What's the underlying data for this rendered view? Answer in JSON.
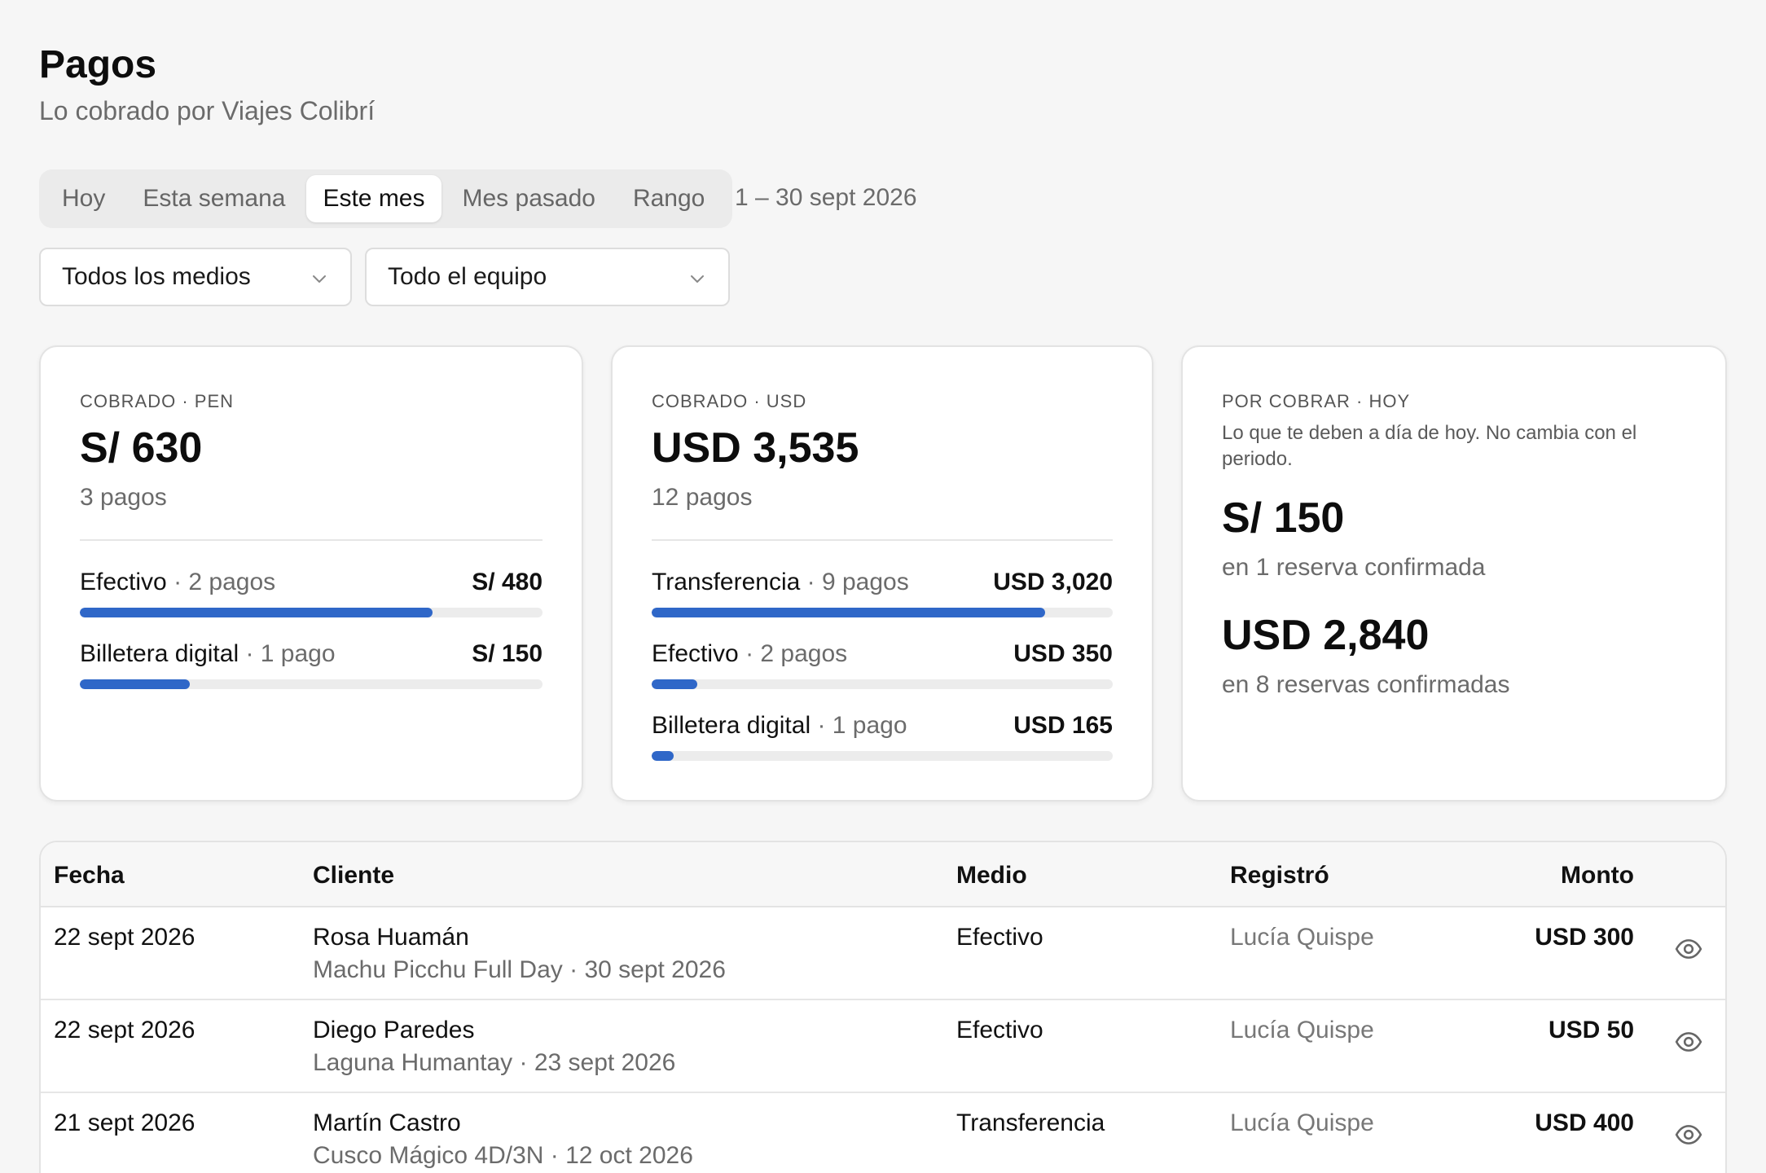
{
  "header": {
    "title": "Pagos",
    "subtitle": "Lo cobrado por Viajes Colibrí"
  },
  "period": {
    "tabs": [
      "Hoy",
      "Esta semana",
      "Este mes",
      "Mes pasado",
      "Rango"
    ],
    "active": "Este mes",
    "range_text": "1 – 30 sept 2026"
  },
  "filters": {
    "method": "Todos los medios",
    "team": "Todo el equipo"
  },
  "cards": {
    "pen": {
      "label": "COBRADO · PEN",
      "total": "S/ 630",
      "count": "3 pagos",
      "rows": [
        {
          "name": "Efectivo",
          "count": "· 2 pagos",
          "amount": "S/ 480",
          "share": 0.762
        },
        {
          "name": "Billetera digital",
          "count": "· 1 pago",
          "amount": "S/ 150",
          "share": 0.238
        }
      ]
    },
    "usd": {
      "label": "COBRADO · USD",
      "total": "USD 3,535",
      "count": "12 pagos",
      "rows": [
        {
          "name": "Transferencia",
          "count": "· 9 pagos",
          "amount": "USD 3,020",
          "share": 0.854
        },
        {
          "name": "Efectivo",
          "count": "· 2 pagos",
          "amount": "USD 350",
          "share": 0.099
        },
        {
          "name": "Billetera digital",
          "count": "· 1 pago",
          "amount": "USD 165",
          "share": 0.047
        }
      ]
    },
    "due": {
      "label": "POR COBRAR · HOY",
      "description": "Lo que te deben a día de hoy. No cambia con el periodo.",
      "pen_amount": "S/ 150",
      "pen_sub": "en 1 reserva confirmada",
      "usd_amount": "USD 2,840",
      "usd_sub": "en 8 reservas confirmadas"
    }
  },
  "table": {
    "headers": {
      "date": "Fecha",
      "client": "Cliente",
      "method": "Medio",
      "by": "Registró",
      "amount": "Monto"
    },
    "rows": [
      {
        "date": "22 sept 2026",
        "client": "Rosa Huamán",
        "detail": "Machu Picchu Full Day · 30 sept 2026",
        "method": "Efectivo",
        "by": "Lucía Quispe",
        "amount": "USD 300"
      },
      {
        "date": "22 sept 2026",
        "client": "Diego Paredes",
        "detail": "Laguna Humantay · 23 sept 2026",
        "method": "Efectivo",
        "by": "Lucía Quispe",
        "amount": "USD 50"
      },
      {
        "date": "21 sept 2026",
        "client": "Martín Castro",
        "detail": "Cusco Mágico 4D/3N · 12 oct 2026",
        "method": "Transferencia",
        "by": "Lucía Quispe",
        "amount": "USD 400"
      }
    ]
  },
  "icons": {
    "dropdown": "chevron-down-icon",
    "view": "eye-icon"
  },
  "colors": {
    "accent": "#2f67c8",
    "background": "#f6f6f6"
  }
}
